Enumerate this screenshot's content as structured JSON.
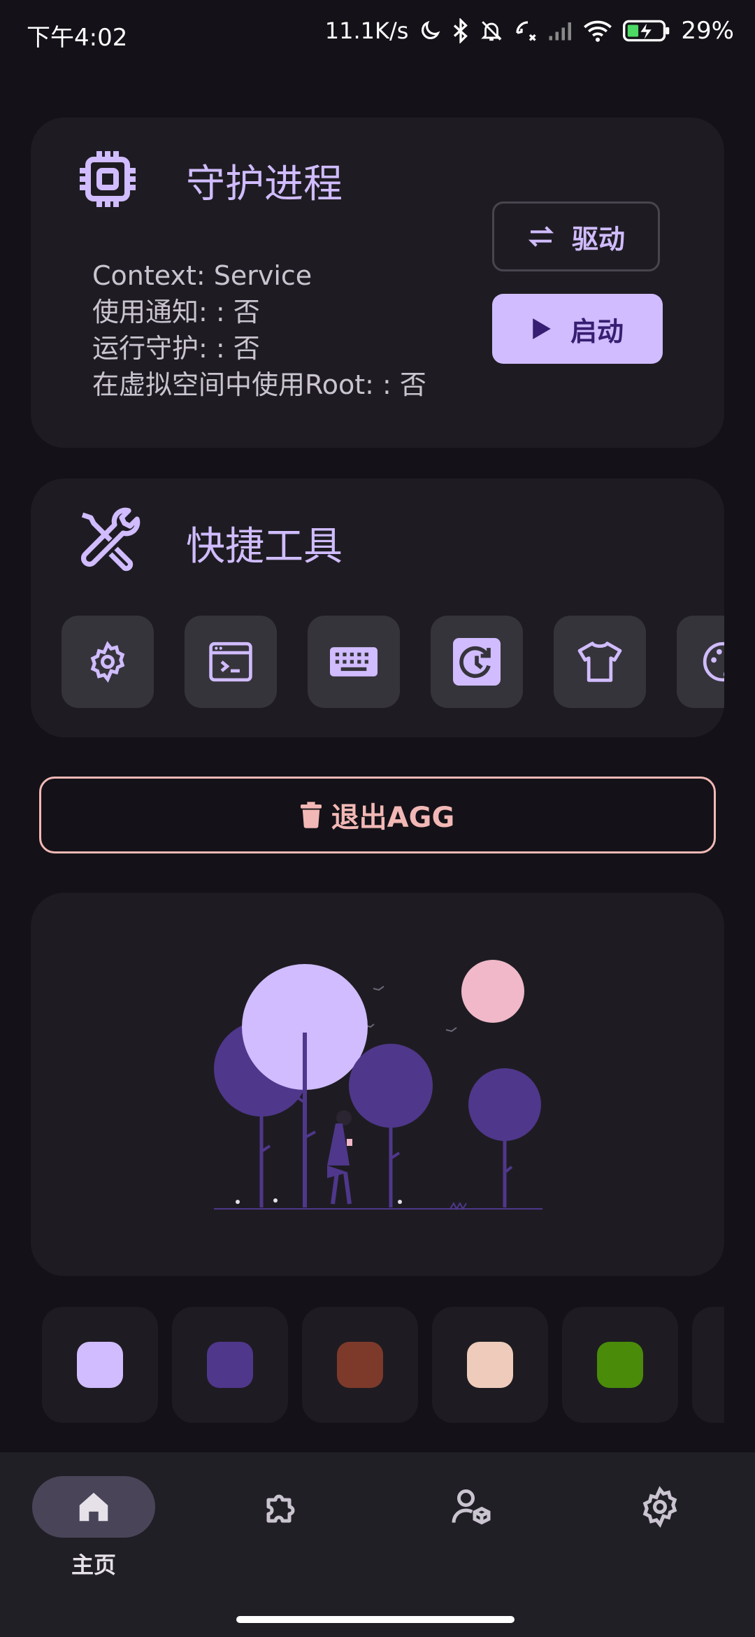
{
  "status_bar": {
    "time": "下午4:02",
    "network_speed": "11.1K/s",
    "battery": "29%",
    "icons": [
      "moon-icon",
      "bluetooth-icon",
      "bell-off-icon",
      "call-icon",
      "signal-icon",
      "wifi-icon",
      "battery-charging-icon"
    ]
  },
  "daemon_card": {
    "title": "守护进程",
    "icon": "cpu-chip-icon",
    "info": [
      "Context: Service",
      "使用通知: : 否",
      "运行守护: : 否",
      "在虚拟空间中使用Root: : 否"
    ],
    "driver_button": "驱动",
    "start_button": "启动"
  },
  "tools_card": {
    "title": "快捷工具",
    "icon": "tools-icon",
    "tools": [
      "settings-icon",
      "terminal-icon",
      "keyboard-icon",
      "clock-icon",
      "shirt-icon",
      "palette-icon"
    ]
  },
  "exit_button": "退出AGG",
  "illustration": "woman-walking-in-forest-illustration",
  "color_swatches": [
    "#D0BCFF",
    "#4F378B",
    "#7D3A2A",
    "#EECBBA",
    "#4A8B0A"
  ],
  "bottom_nav": {
    "items": [
      {
        "label": "主页",
        "icon": "home-icon",
        "active": true
      },
      {
        "label": "",
        "icon": "puzzle-icon",
        "active": false
      },
      {
        "label": "",
        "icon": "user-box-icon",
        "active": false
      },
      {
        "label": "",
        "icon": "gear-icon",
        "active": false
      }
    ]
  },
  "colors": {
    "background": "#141218",
    "surface": "#1E1C22",
    "primary": "#D0BCFF",
    "on_primary": "#381E72",
    "error": "#F2B8B5",
    "nav_background": "#211F26"
  }
}
